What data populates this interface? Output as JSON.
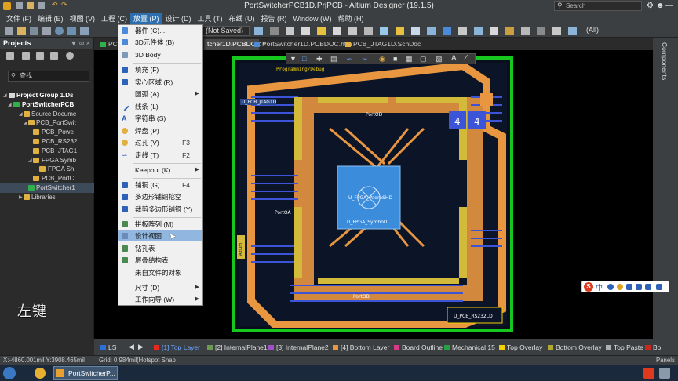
{
  "window": {
    "title": "PortSwitcherPCB1D.PrjPCB - Altium Designer (19.1.5)",
    "search_placeholder": "Search"
  },
  "menubar": {
    "items": [
      {
        "label": "文件 (F)"
      },
      {
        "label": "编辑 (E)"
      },
      {
        "label": "视图 (V)"
      },
      {
        "label": "工程 (C)"
      },
      {
        "label": "放置 (P)",
        "active": true
      },
      {
        "label": "设计 (D)"
      },
      {
        "label": "工具 (T)"
      },
      {
        "label": "布线 (U)"
      },
      {
        "label": "报告 (R)"
      },
      {
        "label": "Window (W)"
      },
      {
        "label": "帮助 (H)"
      }
    ]
  },
  "toolbar": {
    "saved_status": "(Not Saved)",
    "filter_value": "(All)"
  },
  "projects_panel": {
    "title": "Projects",
    "search_placeholder": "查找",
    "tree": [
      {
        "label": "Project Group 1.Ds",
        "level": 0,
        "bold": true
      },
      {
        "label": "PortSwitcherPCB",
        "level": 1,
        "bold": true
      },
      {
        "label": "Source Docume",
        "level": 2
      },
      {
        "label": "PCB_PortSwit",
        "level": 3
      },
      {
        "label": "PCB_Powe",
        "level": 4
      },
      {
        "label": "PCB_RS232",
        "level": 4
      },
      {
        "label": "PCB_JTAG1",
        "level": 4
      },
      {
        "label": "FPGA Symb",
        "level": 4
      },
      {
        "label": "FPGA Sh",
        "level": 5
      },
      {
        "label": "PCB_PortC",
        "level": 4
      },
      {
        "label": "PortSwitcher1",
        "level": 3,
        "selected": true
      },
      {
        "label": "Libraries",
        "level": 2
      }
    ]
  },
  "doc_tabs": [
    {
      "label": "PC",
      "active": false
    },
    {
      "label": "tcher1D.PCBDOC *",
      "active": true
    },
    {
      "label": "PortSwitcher1D.PCBDOC.htm",
      "active": false
    },
    {
      "label": "PCB_JTAG1D.SchDoc",
      "active": false
    }
  ],
  "right_panel_label": "Components",
  "place_menu": {
    "items": [
      {
        "label": "器件 (C)...",
        "icon": "component-icon"
      },
      {
        "label": "3D元件体 (B)",
        "icon": "3d-body-icon"
      },
      {
        "label": "3D Body",
        "icon": "3d-body-alt-icon"
      },
      {
        "sep": true
      },
      {
        "label": "填充 (F)",
        "icon": "fill-icon"
      },
      {
        "label": "实心区域 (R)",
        "icon": "solid-region-icon"
      },
      {
        "label": "圆弧 (A)",
        "submenu": true
      },
      {
        "label": "线条 (L)",
        "icon": "line-icon"
      },
      {
        "label": "字符串 (S)",
        "icon": "string-icon"
      },
      {
        "label": "焊盘 (P)",
        "icon": "pad-icon"
      },
      {
        "label": "过孔 (V)",
        "shortcut": "F3",
        "icon": "via-icon"
      },
      {
        "label": "走线 (T)",
        "shortcut": "F2",
        "icon": "track-icon"
      },
      {
        "sep": true
      },
      {
        "label": "Keepout (K)",
        "submenu": true
      },
      {
        "sep": true
      },
      {
        "label": "铺铜 (G)...",
        "shortcut": "F4",
        "icon": "polygon-pour-icon"
      },
      {
        "label": "多边形铺铜挖空",
        "icon": "polygon-cutout-icon"
      },
      {
        "label": "裁剪多边形铺铜 (Y)",
        "icon": "slice-polygon-icon"
      },
      {
        "sep": true
      },
      {
        "label": "拼板阵列 (M)",
        "icon": "embedded-board-array-icon"
      },
      {
        "label": "设计视图",
        "icon": "design-view-icon",
        "highlighted": true
      },
      {
        "label": "钻孔表",
        "icon": "drill-table-icon"
      },
      {
        "label": "层叠结构表",
        "icon": "layer-stack-table-icon"
      },
      {
        "label": "来自文件的对象",
        "icon": "object-from-file-icon"
      },
      {
        "sep": true
      },
      {
        "label": "尺寸 (D)",
        "submenu": true
      },
      {
        "label": "工作向导 (W)",
        "submenu": true
      }
    ]
  },
  "pcb": {
    "labels": {
      "programming_debug": "Programming/Debug",
      "jtag": "U_PCB_JTAG1D",
      "portod_top": "PortOD",
      "portoa": "PortOA",
      "fpga1": "U_FPGA_PadreSHD",
      "fpga2": "U_FPGA_Symbol1",
      "portob": "PortOB",
      "rs232": "U_PCB_RS232LD",
      "altium": "Altium",
      "num_a": "4",
      "num_b": "4"
    },
    "colors": {
      "board_outline": "#16c81e",
      "top_copper": "#e89640",
      "bottom_copper": "#3c55d8",
      "overlay": "#f3d000",
      "fpga_pad": "#3c8cdc"
    }
  },
  "layers": [
    {
      "label": "LS",
      "color": "#2d6fd6"
    },
    {
      "label": "[1] Top Layer",
      "color": "#e82a1e",
      "active": true
    },
    {
      "label": "[2] InternalPlane1",
      "color": "#6b9b52"
    },
    {
      "label": "[3] InternalPlane2",
      "color": "#a050c8"
    },
    {
      "label": "[4] Bottom Layer",
      "color": "#e89640"
    },
    {
      "label": "Board Outline",
      "color": "#d83a8a"
    },
    {
      "label": "Mechanical 15",
      "color": "#27a045"
    },
    {
      "label": "Top Overlay",
      "color": "#f3d000"
    },
    {
      "label": "Bottom Overlay",
      "color": "#b0a830"
    },
    {
      "label": "Top Paste",
      "color": "#b0b0b0"
    },
    {
      "label": "Bo",
      "color": "#c8281e"
    }
  ],
  "status": {
    "coords": "X:-4860.001mil Y:3908.465mil",
    "grid": "Grid: 0.984mil",
    "snap": "(Hotspot Snap",
    "panels": "Panels"
  },
  "taskbar": {
    "app_label": "PortSwitcherP..."
  },
  "caption": "左键",
  "ime": {
    "brand": "S",
    "lang": "中"
  }
}
